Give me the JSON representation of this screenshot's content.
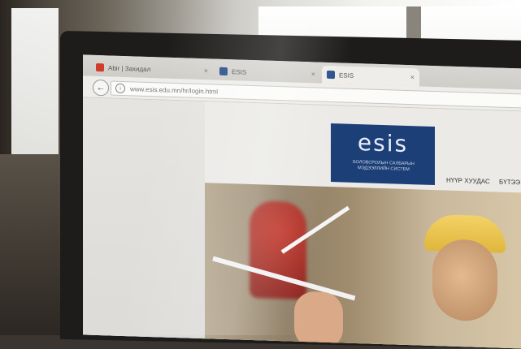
{
  "browser": {
    "tabs": [
      {
        "label": "Abir | Захидал",
        "favicon": "mail-icon",
        "color": "#d23a2c"
      },
      {
        "label": "ESIS",
        "favicon": "esis-icon",
        "color": "#2a4f8c"
      },
      {
        "label": "ESIS",
        "favicon": "esis-icon",
        "color": "#2a4f8c"
      }
    ],
    "close_glyph": "×",
    "back_glyph": "←",
    "info_glyph": "i",
    "url": "www.esis.edu.mn/hr/login.html"
  },
  "site": {
    "logo": "esis",
    "logo_subtitle": "БОЛОВСРОЛЫН САЛБАРЫН МЭДЭЭЛЛИЙН СИСТЕМ",
    "brand_color": "#1d3f78",
    "nav": [
      "НҮҮР ХУУДАС",
      "БҮТЭЭ"
    ]
  }
}
